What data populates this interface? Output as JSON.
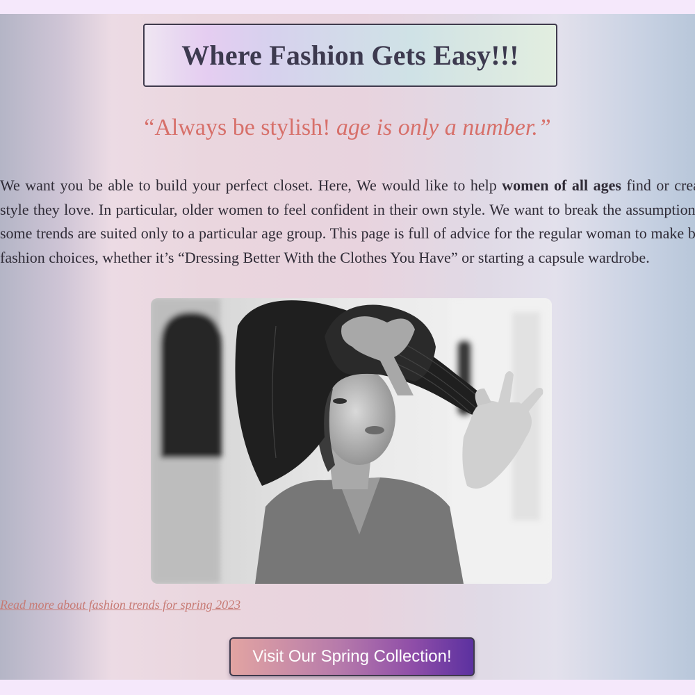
{
  "header": {
    "title": "Where Fashion Gets Easy!!!"
  },
  "quote": {
    "open": "“Always be stylish! ",
    "italic": "age is only a number.”"
  },
  "intro": {
    "part1": "We want you be able to build your perfect closet. Here, We would like to help ",
    "bold": "women of all ages",
    "part2": " find or create a style they love. In particular, older women to feel confident in their own style. We want to break the assumption that some trends are suited only to a particular age group. This page is full of advice for the regular woman to make better fashion choices, whether it’s “Dressing Better With the Clothes You Have” or starting a capsule wardrobe."
  },
  "links": {
    "read_more": "Read more about fashion trends for spring 2023"
  },
  "cta": {
    "label": "Visit Our Spring Collection!"
  },
  "colors": {
    "title_text": "#3d3a4f",
    "quote_text": "#d7706a",
    "link_text": "#c77a74",
    "cta_start": "#e2a4a2",
    "cta_end": "#5c31a0"
  }
}
